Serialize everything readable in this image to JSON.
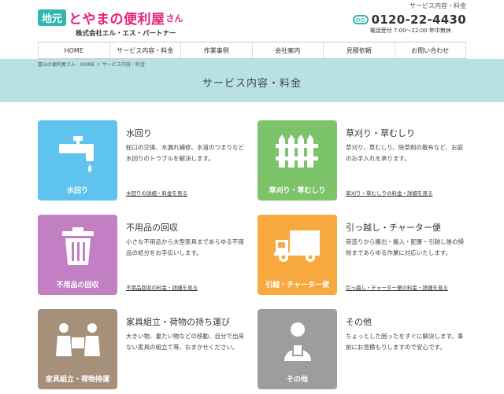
{
  "header": {
    "tagline": "サービス内容・料金",
    "logo_badge": "地元",
    "logo_main": "とやまの便利屋",
    "logo_san": "さん",
    "company": "株式会社エル・エス・パートナー",
    "phone": "0120-22-4430",
    "hours": "電話受付 7:00〜22:00  年中無休"
  },
  "nav": [
    "HOME",
    "サービス内容・料金",
    "作業事例",
    "会社案内",
    "見積依頼",
    "お問い合わせ"
  ],
  "breadcrumb": "富山の便利屋さん　HOME ＞ サービス内容・料金",
  "page_title": "サービス内容・料金",
  "cards": [
    {
      "tile_label": "水回り",
      "title": "水回り",
      "desc": "蛇口の交換、水漏れ補修、水道のつまりなど水回りのトラブルを解決します。",
      "link": "水回りの詳細・料金を見る",
      "color": "#5ec3ee",
      "icon": "faucet-icon"
    },
    {
      "tile_label": "草刈り・草むしり",
      "title": "草刈り・草むしり",
      "desc": "草刈り、草むしり、除草剤の散布など、お庭のお手入れを承ります。",
      "link": "草刈り・草むしりの料金・詳細を見る",
      "color": "#7dc36a",
      "icon": "fence-icon"
    },
    {
      "tile_label": "不用品の回収",
      "title": "不用品の回収",
      "desc": "小さな不用品から大型家具まであらゆる不用品の処分をお手伝いします。",
      "link": "不用品回収の料金・詳細を見る",
      "color": "#c27fc4",
      "icon": "trash-icon"
    },
    {
      "tile_label": "引越・チャーター便",
      "title": "引っ越し・チャーター便",
      "desc": "荷造りから搬出・搬入・配置・引越し後の掃除まであらゆる作業に対応いたします。",
      "link": "引っ越し・チャーター便の料金・詳細を見る",
      "color": "#f7a940",
      "icon": "truck-icon"
    },
    {
      "tile_label": "家具組立・荷物持運",
      "title": "家具組立・荷物の持ち運び",
      "desc": "大きい物、重たい物などの移動、自分で出来ない家具の組立て等、おまかせください。",
      "link": "",
      "color": "#a5907a",
      "icon": "movers-icon"
    },
    {
      "tile_label": "その他",
      "title": "その他",
      "desc": "ちょっとした困ったをすぐに解決します。事前にお見積もりしますので安心です。",
      "link": "",
      "color": "#9e9e9e",
      "icon": "person-icon"
    }
  ]
}
